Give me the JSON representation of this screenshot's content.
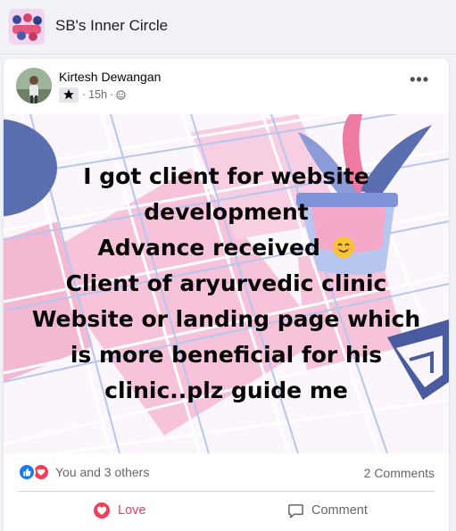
{
  "group": {
    "name": "SB's Inner Circle"
  },
  "post": {
    "author": "Kirtesh Dewangan",
    "time": "15h",
    "separator": "·",
    "more_label": "•••",
    "text_lines": [
      "I got client for website",
      "development",
      "Advance received",
      "Client of aryurvedic clinic",
      "Website or landing page which",
      "is more beneficial for his",
      "clinic..plz guide me"
    ],
    "reactions_text": "You and 3 others",
    "comments_count": "2 Comments",
    "actions": {
      "love": "Love",
      "comment": "Comment"
    }
  },
  "colors": {
    "accent_love": "#f33e58",
    "like_blue": "#1877f2",
    "art_pink": "#f6c3da",
    "art_blue": "#5b6fb0"
  }
}
